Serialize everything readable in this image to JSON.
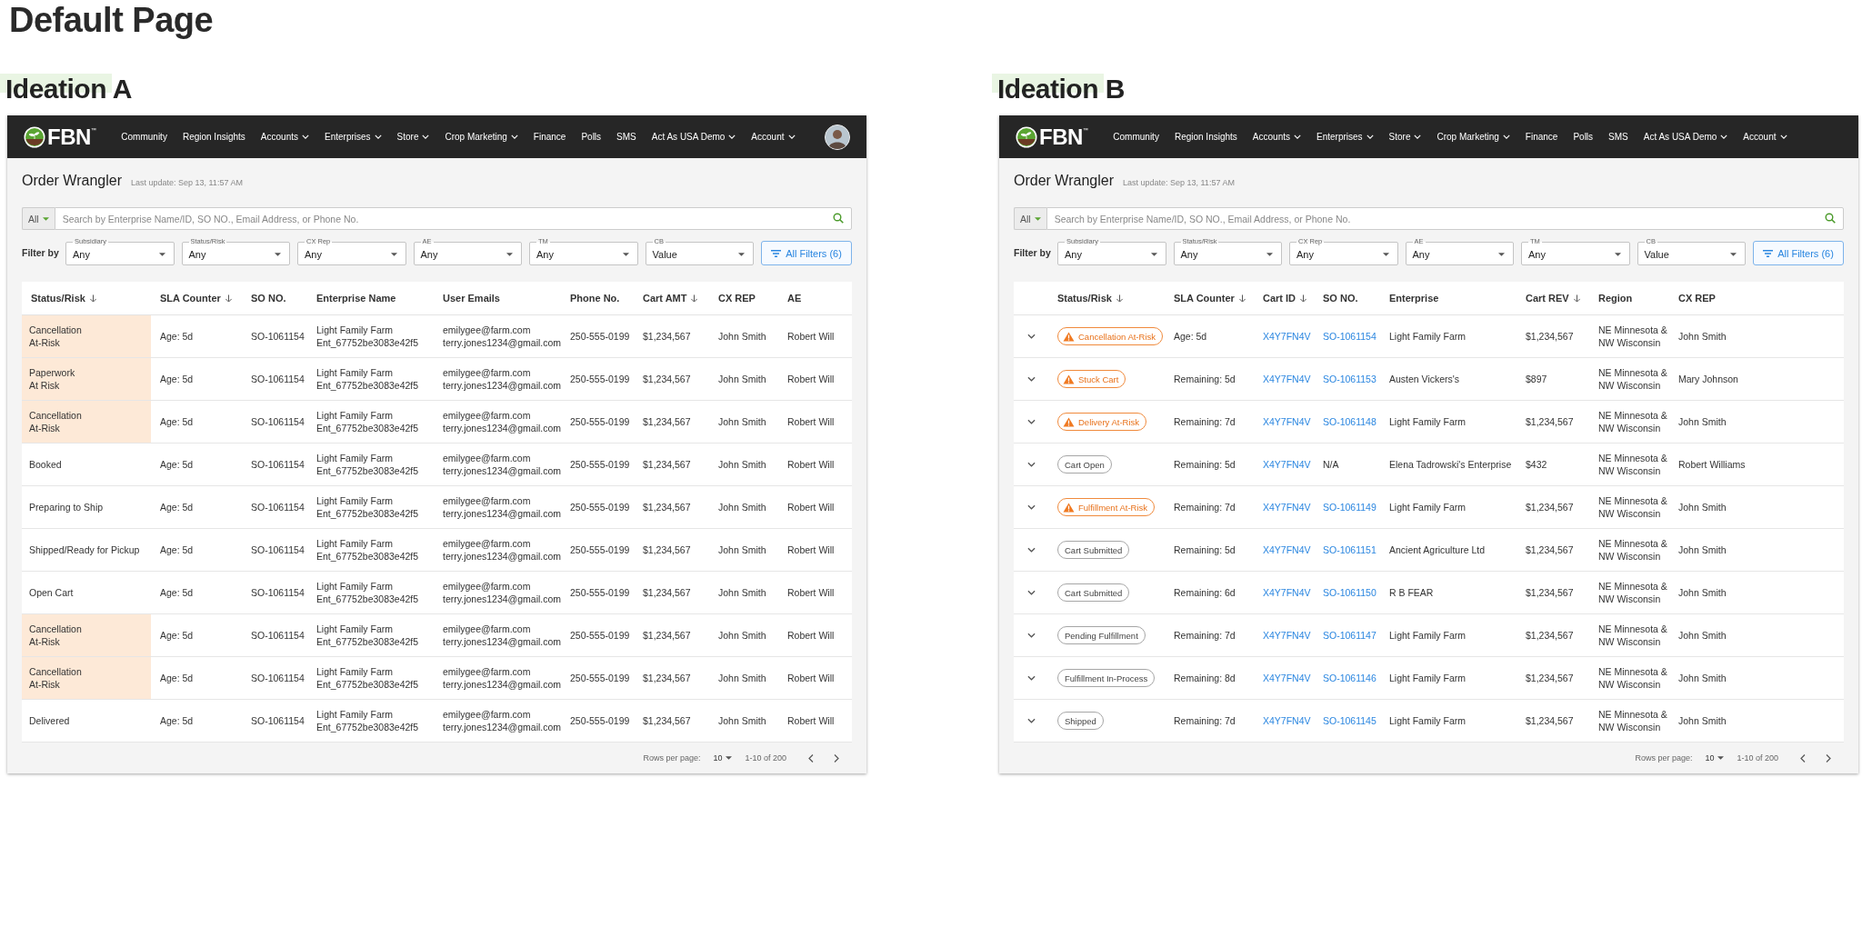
{
  "page_title": "Default Page",
  "boards": [
    {
      "heading": "Ideation A",
      "nav": {
        "logo": "FBN$^{™}$",
        "avatar": true,
        "items": [
          {
            "label": "Community",
            "menu": false
          },
          {
            "label": "Region Insights",
            "menu": false
          },
          {
            "label": "Accounts",
            "menu": true
          },
          {
            "label": "Enterprises",
            "menu": true
          },
          {
            "label": "Store",
            "menu": true
          },
          {
            "label": "Crop Marketing",
            "menu": true
          },
          {
            "label": "Finance",
            "menu": false
          },
          {
            "label": "Polls",
            "menu": false
          },
          {
            "label": "SMS",
            "menu": false
          },
          {
            "label": "Act As USA Demo",
            "menu": true
          },
          {
            "label": "Account",
            "menu": true
          }
        ]
      },
      "app": {
        "title": "Order Wrangler",
        "last_update": "Last update: Sep 13, 11:57 AM",
        "search": {
          "scope": "All",
          "placeholder": "Search by Enterprise Name/ID, SO NO., Email Address, or Phone No."
        },
        "filter_label": "Filter by",
        "filters": [
          {
            "label": "Subsidiary",
            "value": "Any"
          },
          {
            "label": "Status/Risk",
            "value": "Any"
          },
          {
            "label": "CX Rep",
            "value": "Any"
          },
          {
            "label": "AE",
            "value": "Any"
          },
          {
            "label": "TM",
            "value": "Any"
          },
          {
            "label": "CB",
            "value": "Value"
          }
        ],
        "all_filters": "All Filters (6)"
      },
      "table": {
        "kind": "risk_highlight",
        "columns": [
          {
            "label": "Status/Risk",
            "sortable": true
          },
          {
            "label": "SLA Counter",
            "sortable": true
          },
          {
            "label": "SO NO.",
            "sortable": false
          },
          {
            "label": "Enterprise Name",
            "sortable": false
          },
          {
            "label": "User Emails",
            "sortable": false
          },
          {
            "label": "Phone No.",
            "sortable": false
          },
          {
            "label": "Cart AMT",
            "sortable": true
          },
          {
            "label": "CX REP",
            "sortable": false
          },
          {
            "label": "AE",
            "sortable": false
          }
        ],
        "rows": [
          {
            "status": "Cancellation\nAt-Risk",
            "at_risk": true,
            "sla": "Age: 5d",
            "so": "SO-1061154",
            "enterprise": "Light Family Farm",
            "enterprise_id": "Ent_67752be3083e42f5",
            "emails": [
              "emilygee@farm.com",
              "terry.jones1234@gmail.com"
            ],
            "phone": "250-555-0199",
            "cart_amt": "$1,234,567",
            "cx_rep": "John Smith",
            "ae": "Robert Will"
          },
          {
            "status": "Paperwork\nAt Risk",
            "at_risk": true,
            "sla": "Age: 5d",
            "so": "SO-1061154",
            "enterprise": "Light Family Farm",
            "enterprise_id": "Ent_67752be3083e42f5",
            "emails": [
              "emilygee@farm.com",
              "terry.jones1234@gmail.com"
            ],
            "phone": "250-555-0199",
            "cart_amt": "$1,234,567",
            "cx_rep": "John Smith",
            "ae": "Robert Will"
          },
          {
            "status": "Cancellation\nAt-Risk",
            "at_risk": true,
            "sla": "Age: 5d",
            "so": "SO-1061154",
            "enterprise": "Light Family Farm",
            "enterprise_id": "Ent_67752be3083e42f5",
            "emails": [
              "emilygee@farm.com",
              "terry.jones1234@gmail.com"
            ],
            "phone": "250-555-0199",
            "cart_amt": "$1,234,567",
            "cx_rep": "John Smith",
            "ae": "Robert Will"
          },
          {
            "status": "Booked",
            "at_risk": false,
            "sla": "Age: 5d",
            "so": "SO-1061154",
            "enterprise": "Light Family Farm",
            "enterprise_id": "Ent_67752be3083e42f5",
            "emails": [
              "emilygee@farm.com",
              "terry.jones1234@gmail.com"
            ],
            "phone": "250-555-0199",
            "cart_amt": "$1,234,567",
            "cx_rep": "John Smith",
            "ae": "Robert Will"
          },
          {
            "status": "Preparing to Ship",
            "at_risk": false,
            "sla": "Age: 5d",
            "so": "SO-1061154",
            "enterprise": "Light Family Farm",
            "enterprise_id": "Ent_67752be3083e42f5",
            "emails": [
              "emilygee@farm.com",
              "terry.jones1234@gmail.com"
            ],
            "phone": "250-555-0199",
            "cart_amt": "$1,234,567",
            "cx_rep": "John Smith",
            "ae": "Robert Will"
          },
          {
            "status": "Shipped/Ready for Pickup",
            "at_risk": false,
            "sla": "Age: 5d",
            "so": "SO-1061154",
            "enterprise": "Light Family Farm",
            "enterprise_id": "Ent_67752be3083e42f5",
            "emails": [
              "emilygee@farm.com",
              "terry.jones1234@gmail.com"
            ],
            "phone": "250-555-0199",
            "cart_amt": "$1,234,567",
            "cx_rep": "John Smith",
            "ae": "Robert Will"
          },
          {
            "status": "Open Cart",
            "at_risk": false,
            "sla": "Age: 5d",
            "so": "SO-1061154",
            "enterprise": "Light Family Farm",
            "enterprise_id": "Ent_67752be3083e42f5",
            "emails": [
              "emilygee@farm.com",
              "terry.jones1234@gmail.com"
            ],
            "phone": "250-555-0199",
            "cart_amt": "$1,234,567",
            "cx_rep": "John Smith",
            "ae": "Robert Will"
          },
          {
            "status": "Cancellation\nAt-Risk",
            "at_risk": true,
            "sla": "Age: 5d",
            "so": "SO-1061154",
            "enterprise": "Light Family Farm",
            "enterprise_id": "Ent_67752be3083e42f5",
            "emails": [
              "emilygee@farm.com",
              "terry.jones1234@gmail.com"
            ],
            "phone": "250-555-0199",
            "cart_amt": "$1,234,567",
            "cx_rep": "John Smith",
            "ae": "Robert Will"
          },
          {
            "status": "Cancellation\nAt-Risk",
            "at_risk": true,
            "sla": "Age: 5d",
            "so": "SO-1061154",
            "enterprise": "Light Family Farm",
            "enterprise_id": "Ent_67752be3083e42f5",
            "emails": [
              "emilygee@farm.com",
              "terry.jones1234@gmail.com"
            ],
            "phone": "250-555-0199",
            "cart_amt": "$1,234,567",
            "cx_rep": "John Smith",
            "ae": "Robert Will"
          },
          {
            "status": "Delivered",
            "at_risk": false,
            "sla": "Age: 5d",
            "so": "SO-1061154",
            "enterprise": "Light Family Farm",
            "enterprise_id": "Ent_67752be3083e42f5",
            "emails": [
              "emilygee@farm.com",
              "terry.jones1234@gmail.com"
            ],
            "phone": "250-555-0199",
            "cart_amt": "$1,234,567",
            "cx_rep": "John Smith",
            "ae": "Robert Will"
          }
        ]
      },
      "pagination": {
        "rows_label": "Rows per page:",
        "rows_per_page": "10",
        "range": "1-10 of 200"
      }
    },
    {
      "heading": "Ideation B",
      "nav": {
        "logo": "FBN$^{™}$",
        "avatar": false,
        "items": [
          {
            "label": "Community",
            "menu": false
          },
          {
            "label": "Region Insights",
            "menu": false
          },
          {
            "label": "Accounts",
            "menu": true
          },
          {
            "label": "Enterprises",
            "menu": true
          },
          {
            "label": "Store",
            "menu": true
          },
          {
            "label": "Crop Marketing",
            "menu": true
          },
          {
            "label": "Finance",
            "menu": false
          },
          {
            "label": "Polls",
            "menu": false
          },
          {
            "label": "SMS",
            "menu": false
          },
          {
            "label": "Act As USA Demo",
            "menu": true
          },
          {
            "label": "Account",
            "menu": true
          }
        ]
      },
      "app": {
        "title": "Order Wrangler",
        "last_update": "Last update: Sep 13, 11:57 AM",
        "search": {
          "scope": "All",
          "placeholder": "Search by Enterprise Name/ID, SO NO., Email Address, or Phone No."
        },
        "filter_label": "Filter by",
        "filters": [
          {
            "label": "Subsidiary",
            "value": "Any"
          },
          {
            "label": "Status/Risk",
            "value": "Any"
          },
          {
            "label": "CX Rep",
            "value": "Any"
          },
          {
            "label": "AE",
            "value": "Any"
          },
          {
            "label": "TM",
            "value": "Any"
          },
          {
            "label": "CB",
            "value": "Value"
          }
        ],
        "all_filters": "All Filters (6)"
      },
      "table": {
        "kind": "expandable",
        "columns": [
          {
            "label": "Status/Risk",
            "sortable": true
          },
          {
            "label": "SLA Counter",
            "sortable": true
          },
          {
            "label": "Cart ID",
            "sortable": true
          },
          {
            "label": "SO NO.",
            "sortable": false
          },
          {
            "label": "Enterprise",
            "sortable": false
          },
          {
            "label": "Cart REV",
            "sortable": true
          },
          {
            "label": "Region",
            "sortable": false
          },
          {
            "label": "CX REP",
            "sortable": false
          }
        ],
        "rows": [
          {
            "expanded": false,
            "status": "Cancellation At-Risk",
            "at_risk": true,
            "sla": "Age: 5d",
            "cart_id": "X4Y7FN4V",
            "so": "SO-1061154",
            "so_linked": true,
            "enterprise": "Light Family Farm",
            "cart_rev": "$1,234,567",
            "region": "NE Minnesota &\nNW Wisconsin",
            "cx_rep": "John Smith"
          },
          {
            "expanded": false,
            "status": "Stuck Cart",
            "at_risk": true,
            "sla": "Remaining: 5d",
            "cart_id": "X4Y7FN4V",
            "so": "SO-1061153",
            "so_linked": true,
            "enterprise": "Austen Vickers's",
            "cart_rev": "$897",
            "region": "NE Minnesota &\nNW Wisconsin",
            "cx_rep": "Mary Johnson"
          },
          {
            "expanded": false,
            "status": "Delivery At-Risk",
            "at_risk": true,
            "sla": "Remaining: 7d",
            "cart_id": "X4Y7FN4V",
            "so": "SO-1061148",
            "so_linked": true,
            "enterprise": "Light Family Farm",
            "cart_rev": "$1,234,567",
            "region": "NE Minnesota &\nNW Wisconsin",
            "cx_rep": "John Smith"
          },
          {
            "expanded": false,
            "status": "Cart Open",
            "at_risk": false,
            "sla": "Remaining: 5d",
            "cart_id": "X4Y7FN4V",
            "so": "N/A",
            "so_linked": false,
            "enterprise": "Elena Tadrowski's Enterprise",
            "cart_rev": "$432",
            "region": "NE Minnesota &\nNW Wisconsin",
            "cx_rep": "Robert Williams"
          },
          {
            "expanded": false,
            "status": "Fulfillment At-Risk",
            "at_risk": true,
            "sla": "Remaining: 7d",
            "cart_id": "X4Y7FN4V",
            "so": "SO-1061149",
            "so_linked": true,
            "enterprise": "Light Family Farm",
            "cart_rev": "$1,234,567",
            "region": "NE Minnesota &\nNW Wisconsin",
            "cx_rep": "John Smith"
          },
          {
            "expanded": false,
            "status": "Cart Submitted",
            "at_risk": false,
            "sla": "Remaining: 5d",
            "cart_id": "X4Y7FN4V",
            "so": "SO-1061151",
            "so_linked": true,
            "enterprise": "Ancient Agriculture Ltd",
            "cart_rev": "$1,234,567",
            "region": "NE Minnesota &\nNW Wisconsin",
            "cx_rep": "John Smith"
          },
          {
            "expanded": false,
            "status": "Cart Submitted",
            "at_risk": false,
            "sla": "Remaining: 6d",
            "cart_id": "X4Y7FN4V",
            "so": "SO-1061150",
            "so_linked": true,
            "enterprise": "R B FEAR",
            "cart_rev": "$1,234,567",
            "region": "NE Minnesota &\nNW Wisconsin",
            "cx_rep": "John Smith"
          },
          {
            "expanded": false,
            "status": "Pending Fulfillment",
            "at_risk": false,
            "sla": "Remaining: 7d",
            "cart_id": "X4Y7FN4V",
            "so": "SO-1061147",
            "so_linked": true,
            "enterprise": "Light Family Farm",
            "cart_rev": "$1,234,567",
            "region": "NE Minnesota &\nNW Wisconsin",
            "cx_rep": "John Smith"
          },
          {
            "expanded": false,
            "status": "Fulfillment In-Process",
            "at_risk": false,
            "sla": "Remaining: 8d",
            "cart_id": "X4Y7FN4V",
            "so": "SO-1061146",
            "so_linked": true,
            "enterprise": "Light Family Farm",
            "cart_rev": "$1,234,567",
            "region": "NE Minnesota &\nNW Wisconsin",
            "cx_rep": "John Smith"
          },
          {
            "expanded": false,
            "status": "Shipped",
            "at_risk": false,
            "sla": "Remaining: 7d",
            "cart_id": "X4Y7FN4V",
            "so": "SO-1061145",
            "so_linked": true,
            "enterprise": "Light Family Farm",
            "cart_rev": "$1,234,567",
            "region": "NE Minnesota &\nNW Wisconsin",
            "cx_rep": "John Smith"
          }
        ]
      },
      "pagination": {
        "rows_label": "Rows per page:",
        "rows_per_page": "10",
        "range": "1-10 of 200"
      }
    }
  ]
}
